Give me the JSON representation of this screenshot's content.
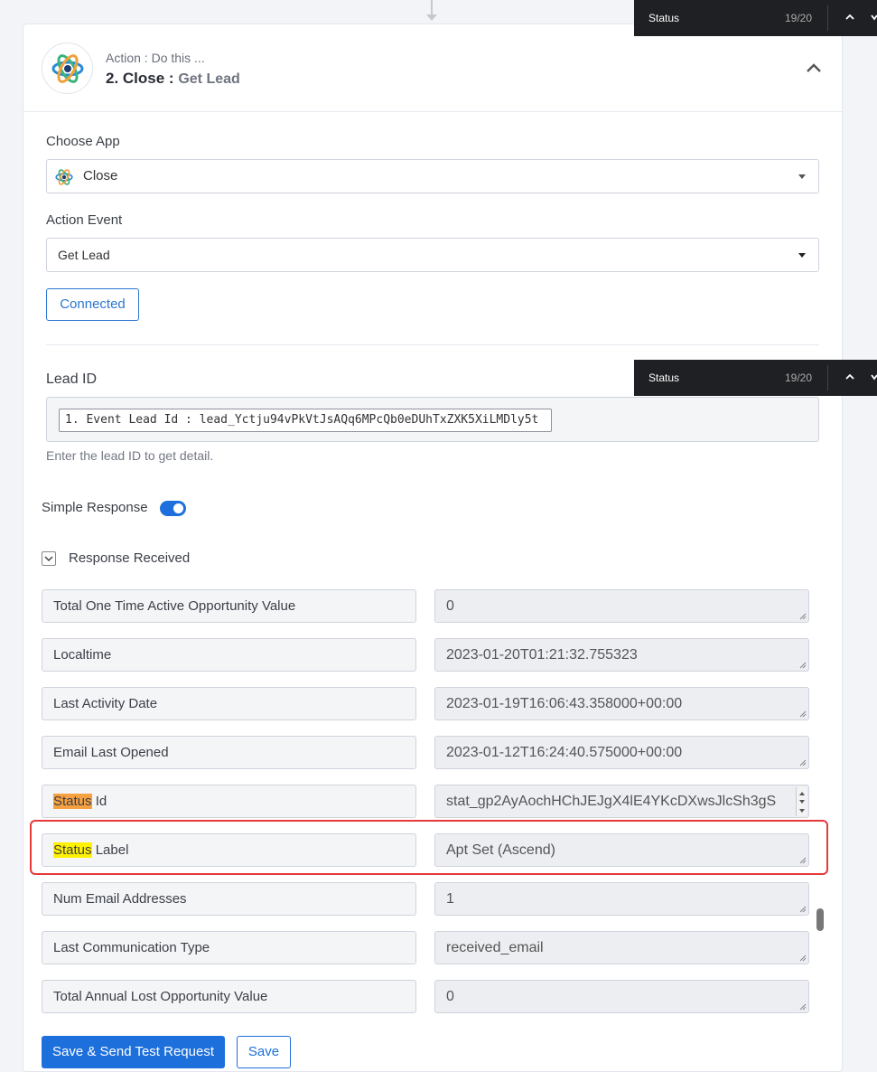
{
  "findbar": {
    "query": "Status",
    "count": "19/20"
  },
  "step": {
    "subtitle": "Action : Do this ...",
    "title": "2. Close :",
    "event": "Get Lead"
  },
  "form": {
    "choose_app_label": "Choose App",
    "app_value": "Close",
    "action_event_label": "Action Event",
    "action_event_value": "Get Lead",
    "connected_label": "Connected",
    "lead_id_label": "Lead ID",
    "lead_id_value": "1. Event Lead Id : lead_Yctju94vPkVtJsAQq6MPcQb0eDUhTxZXK5XiLMDly5t",
    "lead_id_help": "Enter the lead ID to get detail.",
    "simple_response_label": "Simple Response",
    "response_received_label": "Response Received"
  },
  "response_rows": [
    {
      "key": "Total One Time Active Opportunity Value",
      "value": "0"
    },
    {
      "key": "Localtime",
      "value": "2023-01-20T01:21:32.755323"
    },
    {
      "key": "Last Activity Date",
      "value": "2023-01-19T16:06:43.358000+00:00"
    },
    {
      "key": "Email Last Opened",
      "value": "2023-01-12T16:24:40.575000+00:00"
    },
    {
      "key_highlight": "Status",
      "key_rest": " Id",
      "value": "stat_gp2AyAochHChJEJgX4lE4YKcDXwsJlcSh3gS"
    },
    {
      "key_highlight": "Status",
      "key_rest": " Label",
      "value": "Apt Set (Ascend)"
    },
    {
      "key": "Num Email Addresses",
      "value": "1"
    },
    {
      "key": "Last Communication Type",
      "value": "received_email"
    },
    {
      "key": "Total Annual Lost Opportunity Value",
      "value": "0"
    }
  ],
  "buttons": {
    "save_send": "Save & Send Test Request",
    "save": "Save"
  }
}
